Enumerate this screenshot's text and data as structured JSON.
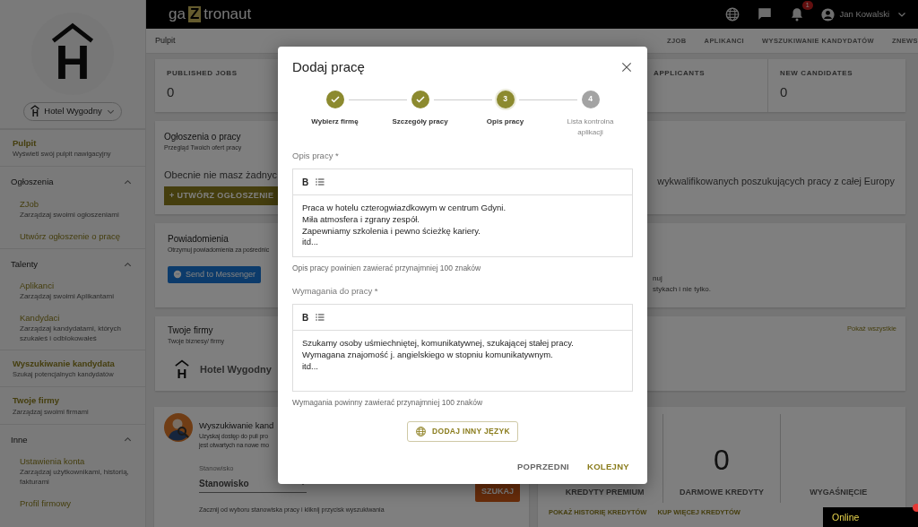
{
  "topbar": {
    "logo": [
      "ga",
      "Z",
      "tronaut"
    ],
    "notification_count": "1",
    "user": "Jan Kowalski"
  },
  "sidebar": {
    "logo_letter": "H",
    "company_select": {
      "logo_letter": "H",
      "value": "Hotel Wygodny"
    },
    "items": [
      {
        "kind": "link",
        "title": "Pulpit",
        "subtitle": "Wyświetl swój pulpit nawigacyjny"
      },
      {
        "kind": "group",
        "title": "Ogłoszenia",
        "expanded": true,
        "children": [
          {
            "title": "ZJob",
            "subtitle": "Zarządzaj swoimi ogłoszeniami"
          },
          {
            "title": "Utwórz ogłoszenie o pracę"
          }
        ]
      },
      {
        "kind": "group",
        "title": "Talenty",
        "expanded": true,
        "children": [
          {
            "title": "Aplikanci",
            "subtitle": "Zarządzaj swoimi Aplikantami"
          },
          {
            "title": "Kandydaci",
            "subtitle": "Zarządzaj kandydatami, których szukałeś i odblokowałeś"
          }
        ]
      },
      {
        "kind": "link",
        "title": "Wyszukiwanie kandydata",
        "subtitle": "Szukaj potencjalnych kandydatów"
      },
      {
        "kind": "link",
        "title": "Twoje firmy",
        "subtitle": "Zarządzaj swoimi firmami"
      },
      {
        "kind": "group",
        "title": "Inne",
        "expanded": true,
        "children": [
          {
            "title": "Ustawienia konta",
            "subtitle": "Zarządzaj użytkownikami, historią, fakturami"
          },
          {
            "title": "Profil firmowy"
          }
        ]
      }
    ]
  },
  "subnav": {
    "title": "Pulpit",
    "links": [
      "ZJOB",
      "APLIKANCI",
      "WYSZUKIWANIE KANDYDATÓW",
      "ZNEWS"
    ]
  },
  "stats": [
    {
      "label": "PUBLISHED JOBS",
      "value": "0"
    },
    {
      "label": "APPLICANTS"
    },
    {
      "label": "NEW CANDIDATES",
      "value": "0"
    }
  ],
  "jobs_card": {
    "title": "Ogłoszenia o pracy",
    "subtitle": "Przegląd Twoich ofert pracy",
    "text_left": "Obecnie nie masz żadnyc",
    "text_right": "wykwalifikowanych poszukujących pracy z całej Europy",
    "button": "+ UTWÓRZ OGŁOSZENIE"
  },
  "notifications_card": {
    "title": "Powiadomienia",
    "subtitle": "Otrzymuj powiadomienia za pośrednic",
    "button": "Send to Messenger",
    "text_right": [
      "nuj",
      "stykach i nie tylko."
    ]
  },
  "companies_card": {
    "title": "Twoje firmy",
    "subtitle": "Twoje biznesy/ firmy",
    "link": "Pokaż wszystkie",
    "companies": [
      {
        "logo_letter": "H",
        "name": "Hotel Wygodny"
      }
    ]
  },
  "search_card": {
    "title": "Wyszukiwanie kand",
    "lines": [
      "Uzyskaj dostęp do puli pro",
      "jest otwartych na nowe mo"
    ],
    "field_label": "Stanowisko",
    "field_value": "Stanowisko",
    "hint": "Zacznij od wyboru stanowiska pracy i kliknij przycisk wyszukiwania",
    "button": "SZUKAJ"
  },
  "credits_card": {
    "columns": [
      {
        "label": "KREDYTY PREMIUM"
      },
      {
        "value": "0",
        "label": "DARMOWE KREDYTY"
      },
      {
        "label": "WYGAŚNIĘCIE"
      }
    ],
    "links": [
      "POKAŻ HISTORIĘ KREDYTÓW",
      "KUP WIĘCEJ KREDYTÓW"
    ]
  },
  "chat_widget": {
    "label": "Online"
  },
  "modal": {
    "title": "Dodaj pracę",
    "steps": [
      {
        "label": "Wybierz firmę",
        "completed": true,
        "selected": false
      },
      {
        "label": "Szczegóły pracy",
        "completed": true,
        "selected": false
      },
      {
        "number": "3",
        "label": "Opis pracy",
        "completed": false,
        "selected": true
      },
      {
        "number": "4",
        "label": "Lista kontrolna aplikacji",
        "completed": false,
        "selected": false
      }
    ],
    "editors": [
      {
        "label": "Opis pracy *",
        "bold_button": "B",
        "lines": [
          "Praca w hotelu czterogwiazdkowym w centrum Gdyni.",
          "Miła atmosfera i zgrany zespół.",
          "Zapewniamy szkolenia i pewno ścieżkę kariery.",
          "itd..."
        ],
        "hint": "Opis pracy powinien zawierać przynajmniej 100 znaków"
      },
      {
        "label": "Wymagania do pracy *",
        "bold_button": "B",
        "lines": [
          "Szukamy osoby uśmiechniętej, komunikatywnej, szukającej stałej pracy.",
          "Wymagana znajomość j. angielskiego w stopniu komunikatywnym.",
          "itd..."
        ],
        "hint": "Wymagania powinny zawierać przynajmniej 100 znaków"
      }
    ],
    "add_language_button": "DODAJ INNY JĘZYK",
    "buttons": [
      {
        "label": "POPRZEDNI",
        "primary": false
      },
      {
        "label": "KOLEJNY",
        "primary": true
      }
    ]
  }
}
